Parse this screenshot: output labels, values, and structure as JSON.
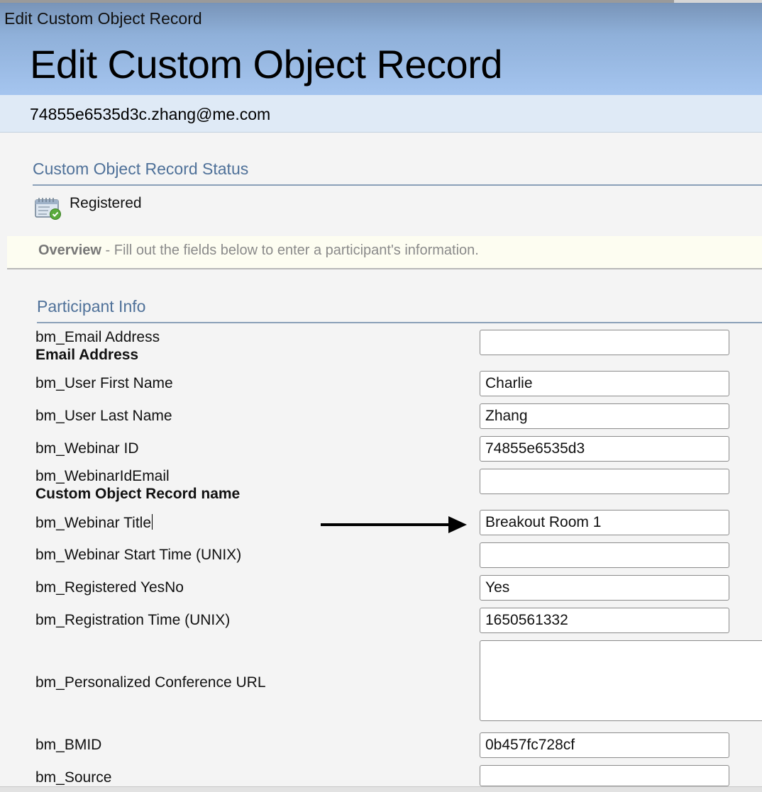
{
  "window": {
    "title": "Edit Custom Object Record"
  },
  "header": {
    "page_title": "Edit Custom Object Record"
  },
  "record": {
    "identifier": "74855e6535d3c.zhang@me.com"
  },
  "status_section": {
    "title": "Custom Object Record Status",
    "icon": "calendar-check-icon",
    "status": "Registered"
  },
  "overview": {
    "label": "Overview",
    "text": " - Fill out the fields below to enter a participant's information."
  },
  "participant_section": {
    "title": "Participant Info",
    "fields": [
      {
        "label": "bm_Email Address",
        "sublabel": "Email Address",
        "value": ""
      },
      {
        "label": "bm_User First Name",
        "value": "Charlie"
      },
      {
        "label": "bm_User Last Name",
        "value": "Zhang"
      },
      {
        "label": "bm_Webinar ID",
        "value": "74855e6535d3"
      },
      {
        "label": "bm_WebinarIdEmail",
        "sublabel": "Custom Object Record name",
        "value": ""
      },
      {
        "label": "bm_Webinar Title",
        "value": "Breakout Room 1"
      },
      {
        "label": "bm_Webinar Start Time (UNIX)",
        "value": ""
      },
      {
        "label": "bm_Registered YesNo",
        "value": "Yes"
      },
      {
        "label": "bm_Registration Time (UNIX)",
        "value": "1650561332"
      },
      {
        "label": "bm_Personalized Conference URL",
        "value": ""
      },
      {
        "label": "bm_BMID",
        "value": "0b457fc728cf"
      },
      {
        "label": "bm_Source",
        "value": ""
      }
    ]
  },
  "annotation": {
    "icon": "arrow-right-icon"
  },
  "colors": {
    "header_gradient_top": "#7894b8",
    "header_gradient_bottom": "#a5c5ef",
    "section_title": "#4f7199",
    "overview_bg": "#fdfdf1"
  }
}
